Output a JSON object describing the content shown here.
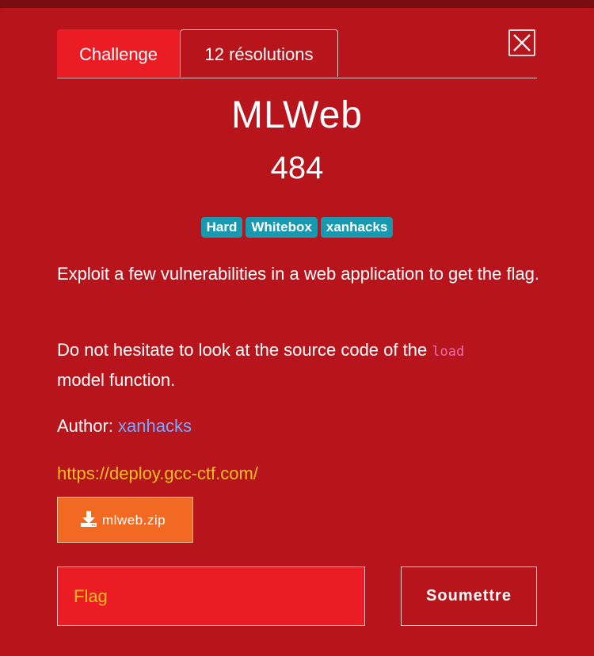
{
  "tabs": [
    {
      "label": "Challenge",
      "active": true
    },
    {
      "label": "12 résolutions",
      "active": false
    }
  ],
  "challenge": {
    "title": "MLWeb",
    "points": "484",
    "tags": [
      "Hard",
      "Whitebox",
      "xanhacks"
    ],
    "description_p1": "Exploit a few vulnerabilities in a web application to get the flag.",
    "description_p2_before": "Do not hesitate to look at the source code of the ",
    "description_p2_code": "load",
    "description_p2_after": " model function.",
    "author_label": "Author: ",
    "author_name": "xanhacks",
    "url": "https://deploy.gcc-ctf.com/",
    "file_name": "mlweb.zip"
  },
  "form": {
    "flag_placeholder": "Flag",
    "submit_label": "Soumettre"
  },
  "icons": {
    "close": "close-icon",
    "download": "download-icon"
  },
  "colors": {
    "modal_bg": "#b8141c",
    "active_tab": "#ec1c24",
    "tag_bg": "#1899b0",
    "link_author": "#79a6ff",
    "link_url": "#f7c11a",
    "file_button": "#f26a22",
    "code": "#f06fb0"
  }
}
